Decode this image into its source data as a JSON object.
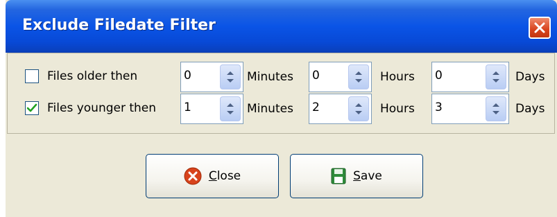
{
  "window": {
    "title": "Exclude Filedate Filter",
    "close_icon": "close-x-icon"
  },
  "filters": [
    {
      "label": "Files older then",
      "checked": false,
      "minutes": "0",
      "hours": "0",
      "days": "0"
    },
    {
      "label": "Files younger then",
      "checked": true,
      "minutes": "1",
      "hours": "2",
      "days": "3"
    }
  ],
  "units": {
    "minutes": "Minutes",
    "hours": "Hours",
    "days": "Days"
  },
  "buttons": {
    "close": {
      "accel": "C",
      "rest": "lose",
      "icon": "red-x-circle-icon"
    },
    "save": {
      "accel": "S",
      "rest": "ave",
      "icon": "floppy-disk-icon"
    }
  },
  "colors": {
    "titlebar": "#0a54e6",
    "dialog_bg": "#ece9d8",
    "check_mark": "#21a121",
    "close_red": "#d8431c"
  }
}
